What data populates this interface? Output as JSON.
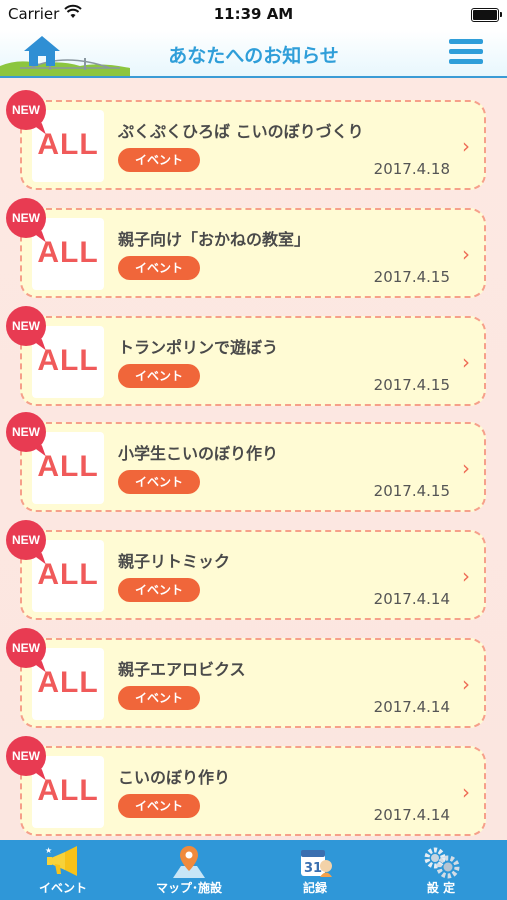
{
  "status_bar": {
    "carrier": "Carrier",
    "time": "11:39 AM"
  },
  "header": {
    "title": "あなたへのお知らせ"
  },
  "notices": [
    {
      "badge": "NEW",
      "thumb": "ALL",
      "title": "ぷくぷくひろば こいのぼりづくり",
      "tag": "イベント",
      "date": "2017.4.18"
    },
    {
      "badge": "NEW",
      "thumb": "ALL",
      "title": "親子向け「おかねの教室」",
      "tag": "イベント",
      "date": "2017.4.15"
    },
    {
      "badge": "NEW",
      "thumb": "ALL",
      "title": "トランポリンで遊ぼう",
      "tag": "イベント",
      "date": "2017.4.15"
    },
    {
      "badge": "NEW",
      "thumb": "ALL",
      "title": "小学生こいのぼり作り",
      "tag": "イベント",
      "date": "2017.4.15"
    },
    {
      "badge": "NEW",
      "thumb": "ALL",
      "title": "親子リトミック",
      "tag": "イベント",
      "date": "2017.4.14"
    },
    {
      "badge": "NEW",
      "thumb": "ALL",
      "title": "親子エアロビクス",
      "tag": "イベント",
      "date": "2017.4.14"
    },
    {
      "badge": "NEW",
      "thumb": "ALL",
      "title": "こいのぼり作り",
      "tag": "イベント",
      "date": "2017.4.14"
    }
  ],
  "tabbar": {
    "items": [
      {
        "label": "イベント",
        "icon": "megaphone-icon"
      },
      {
        "label": "マップ･施設",
        "icon": "map-pin-icon"
      },
      {
        "label": "記録",
        "icon": "calendar-icon",
        "calendar_day": "31"
      },
      {
        "label": "設 定",
        "icon": "gear-icon"
      }
    ]
  },
  "colors": {
    "header_blue": "#2f9ed9",
    "tabbar_blue": "#2f97d8",
    "badge_red": "#e83b52",
    "tag_orange": "#f0663a",
    "card_bg": "#fffbd4",
    "card_border": "#f6a08a",
    "all_text": "#f05a5a"
  }
}
